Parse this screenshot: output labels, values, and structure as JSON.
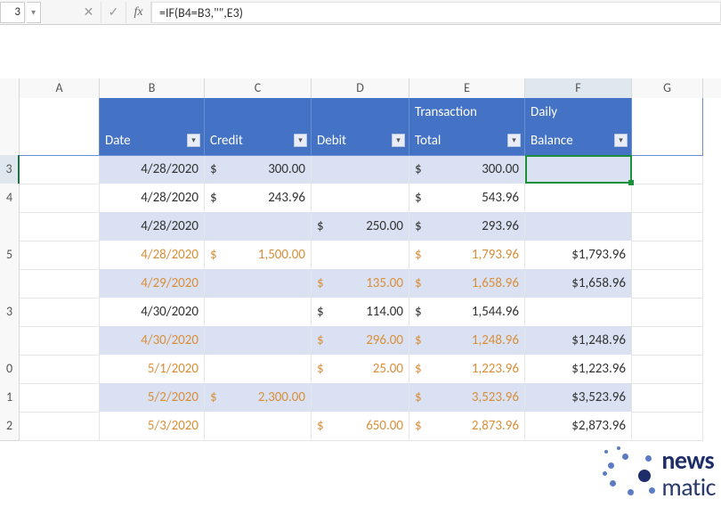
{
  "formula_bar": {
    "namebox_value": "3",
    "formula": "=IF(B4=B3,\"\",E3)"
  },
  "columns": [
    "",
    "A",
    "B",
    "C",
    "D",
    "E",
    "F",
    "G"
  ],
  "selected_column": "F",
  "row_numbers": [
    "",
    "",
    "3",
    "4",
    "",
    "5",
    "",
    "3",
    "",
    "0",
    "1",
    "2"
  ],
  "selected_row_index": 2,
  "table": {
    "headers": {
      "date": "Date",
      "credit": "Credit",
      "debit": "Debit",
      "total_pre": "Transaction",
      "total": "Total",
      "balance_pre": "Daily",
      "balance": "Balance"
    },
    "rows": [
      {
        "date": "4/28/2020",
        "credit_sym": "$",
        "credit": "300.00",
        "debit_sym": "",
        "debit": "",
        "total_sym": "$",
        "total": "300.00",
        "balance": "",
        "orange": false,
        "band": "light"
      },
      {
        "date": "4/28/2020",
        "credit_sym": "$",
        "credit": "243.96",
        "debit_sym": "",
        "debit": "",
        "total_sym": "$",
        "total": "543.96",
        "balance": "",
        "orange": false,
        "band": "white"
      },
      {
        "date": "4/28/2020",
        "credit_sym": "",
        "credit": "",
        "debit_sym": "$",
        "debit": "250.00",
        "total_sym": "$",
        "total": "293.96",
        "balance": "",
        "orange": false,
        "band": "light"
      },
      {
        "date": "4/28/2020",
        "credit_sym": "$",
        "credit": "1,500.00",
        "debit_sym": "",
        "debit": "",
        "total_sym": "$",
        "total": "1,793.96",
        "balance": "$1,793.96",
        "orange": true,
        "band": "white"
      },
      {
        "date": "4/29/2020",
        "credit_sym": "",
        "credit": "",
        "debit_sym": "$",
        "debit": "135.00",
        "total_sym": "$",
        "total": "1,658.96",
        "balance": "$1,658.96",
        "orange": true,
        "band": "light"
      },
      {
        "date": "4/30/2020",
        "credit_sym": "",
        "credit": "",
        "debit_sym": "$",
        "debit": "114.00",
        "total_sym": "$",
        "total": "1,544.96",
        "balance": "",
        "orange": false,
        "band": "white"
      },
      {
        "date": "4/30/2020",
        "credit_sym": "",
        "credit": "",
        "debit_sym": "$",
        "debit": "296.00",
        "total_sym": "$",
        "total": "1,248.96",
        "balance": "$1,248.96",
        "orange": true,
        "band": "light"
      },
      {
        "date": "5/1/2020",
        "credit_sym": "",
        "credit": "",
        "debit_sym": "$",
        "debit": "25.00",
        "total_sym": "$",
        "total": "1,223.96",
        "balance": "$1,223.96",
        "orange": true,
        "band": "white"
      },
      {
        "date": "5/2/2020",
        "credit_sym": "$",
        "credit": "2,300.00",
        "debit_sym": "",
        "debit": "",
        "total_sym": "$",
        "total": "3,523.96",
        "balance": "$3,523.96",
        "orange": true,
        "band": "light"
      },
      {
        "date": "5/3/2020",
        "credit_sym": "",
        "credit": "",
        "debit_sym": "$",
        "debit": "650.00",
        "total_sym": "$",
        "total": "2,873.96",
        "balance": "$2,873.96",
        "orange": true,
        "band": "white"
      }
    ]
  },
  "logo": {
    "brand1": "news",
    "brand2": "matic"
  },
  "icons": {
    "dropdown": "▾",
    "cancel": "✕",
    "enter": "✓",
    "fx": "fx"
  }
}
